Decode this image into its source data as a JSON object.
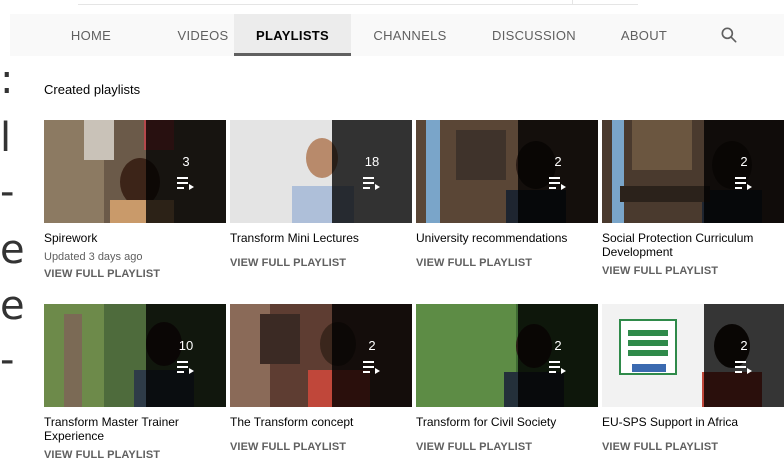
{
  "tabs": [
    {
      "label": "HOME"
    },
    {
      "label": "VIDEOS"
    },
    {
      "label": "PLAYLISTS"
    },
    {
      "label": "CHANNELS"
    },
    {
      "label": "DISCUSSION"
    },
    {
      "label": "ABOUT"
    }
  ],
  "active_tab": "PLAYLISTS",
  "section_title": "Created playlists",
  "view_full_label": "VIEW FULL PLAYLIST",
  "playlists": [
    {
      "title": "Spirework",
      "count": "3",
      "updated": "Updated 3 days ago"
    },
    {
      "title": "Transform Mini Lectures",
      "count": "18"
    },
    {
      "title": "University recommendations",
      "count": "2"
    },
    {
      "title": "Social Protection Curriculum Development",
      "count": "2"
    },
    {
      "title": "Transform Master Trainer Experience",
      "count": "10"
    },
    {
      "title": "The Transform concept",
      "count": "2"
    },
    {
      "title": "Transform for Civil Society",
      "count": "2"
    },
    {
      "title": "EU-SPS Support in Africa",
      "count": "2"
    }
  ],
  "colors": {
    "tab_bar_bg": "#f9f9f9",
    "active_tab_bg": "#ececec",
    "active_indicator": "#606060",
    "text_primary": "#030303",
    "text_secondary": "#606060"
  }
}
